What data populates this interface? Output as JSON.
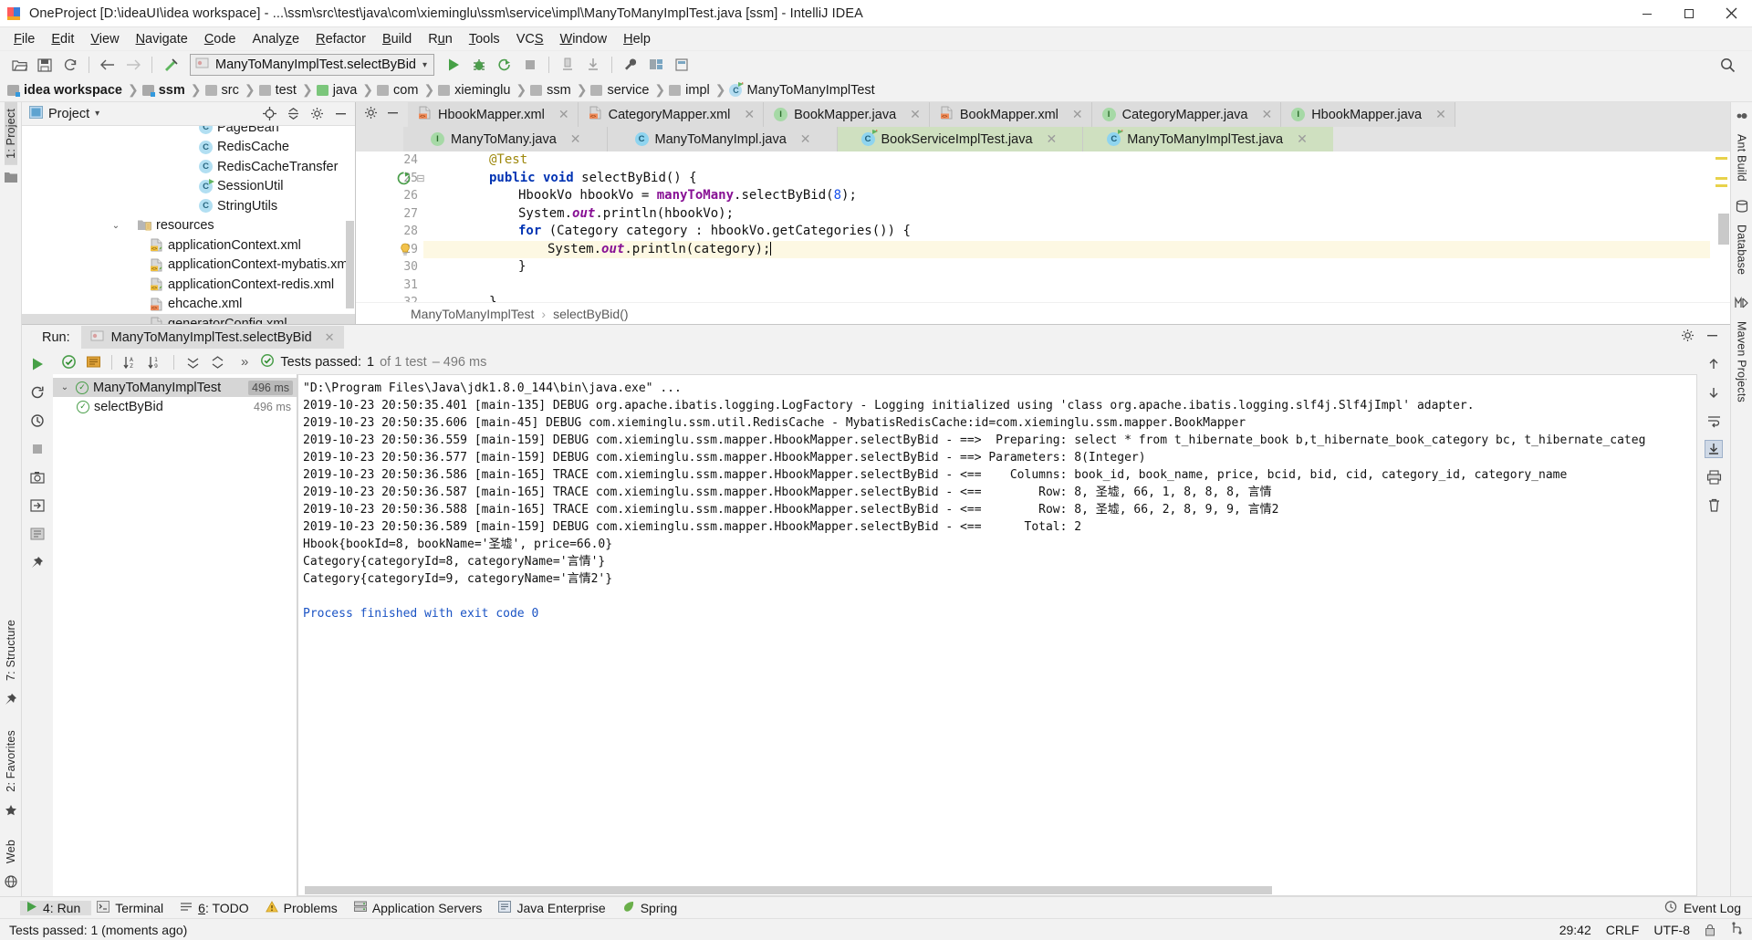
{
  "window": {
    "title": "OneProject [D:\\ideaUI\\idea workspace] - ...\\ssm\\src\\test\\java\\com\\xieminglu\\ssm\\service\\impl\\ManyToManyImplTest.java [ssm] - IntelliJ IDEA",
    "minimize_label": "Minimize",
    "maximize_label": "Maximize",
    "close_label": "Close"
  },
  "menubar": {
    "items": [
      {
        "label": "File"
      },
      {
        "label": "Edit"
      },
      {
        "label": "View"
      },
      {
        "label": "Navigate"
      },
      {
        "label": "Code"
      },
      {
        "label": "Analyze"
      },
      {
        "label": "Refactor"
      },
      {
        "label": "Build"
      },
      {
        "label": "Run"
      },
      {
        "label": "Tools"
      },
      {
        "label": "VCS"
      },
      {
        "label": "Window"
      },
      {
        "label": "Help"
      }
    ]
  },
  "toolbar": {
    "run_config": "ManyToManyImplTest.selectByBid",
    "icons": [
      "open-folder-icon",
      "save-icon",
      "sync-icon",
      "back-arrow-icon",
      "forward-arrow-icon",
      "build-icon",
      "run-icon",
      "debug-icon",
      "run-coverage-icon",
      "stop-icon",
      "profiler-icon",
      "update-app-icon",
      "settings-wrench-icon",
      "project-structure-icon",
      "sdk-manager-icon",
      "search-everywhere-icon"
    ]
  },
  "breadcrumbs": [
    {
      "label": "idea workspace",
      "icon": "module-folder-icon",
      "bold": true
    },
    {
      "label": "ssm",
      "icon": "module-folder-icon",
      "bold": true
    },
    {
      "label": "src",
      "icon": "folder-icon",
      "bold": false
    },
    {
      "label": "test",
      "icon": "folder-icon",
      "bold": false
    },
    {
      "label": "java",
      "icon": "source-root-folder-icon",
      "bold": false
    },
    {
      "label": "com",
      "icon": "package-icon",
      "bold": false
    },
    {
      "label": "xieminglu",
      "icon": "package-icon",
      "bold": false
    },
    {
      "label": "ssm",
      "icon": "package-icon",
      "bold": false
    },
    {
      "label": "service",
      "icon": "package-icon",
      "bold": false
    },
    {
      "label": "impl",
      "icon": "package-icon",
      "bold": false
    },
    {
      "label": "ManyToManyImplTest",
      "icon": "test-class-icon",
      "bold": false
    }
  ],
  "project_pane": {
    "title": "Project",
    "tree": [
      {
        "label": "PageBean",
        "icon": "class-icon",
        "indent": 4,
        "clipped": true
      },
      {
        "label": "RedisCache",
        "icon": "class-icon",
        "indent": 4
      },
      {
        "label": "RedisCacheTransfer",
        "icon": "class-icon",
        "indent": 4
      },
      {
        "label": "SessionUtil",
        "icon": "runnable-class-icon",
        "indent": 4
      },
      {
        "label": "StringUtils",
        "icon": "class-icon",
        "indent": 4
      },
      {
        "label": "resources",
        "icon": "resource-folder-icon",
        "indent": 2,
        "expanded": true
      },
      {
        "label": "applicationContext.xml",
        "icon": "spring-xml-icon",
        "indent": 3
      },
      {
        "label": "applicationContext-mybatis.xml",
        "icon": "spring-xml-icon",
        "indent": 3
      },
      {
        "label": "applicationContext-redis.xml",
        "icon": "spring-xml-icon",
        "indent": 3
      },
      {
        "label": "ehcache.xml",
        "icon": "xml-icon",
        "indent": 3
      },
      {
        "label": "generatorConfig.xml",
        "icon": "xml-icon",
        "indent": 3,
        "clipped": true
      }
    ]
  },
  "editor": {
    "tabs_row1": [
      {
        "label": "HbookMapper.xml",
        "icon": "xml-icon",
        "active": false
      },
      {
        "label": "CategoryMapper.xml",
        "icon": "xml-icon",
        "active": false
      },
      {
        "label": "BookMapper.java",
        "icon": "interface-icon",
        "active": false
      },
      {
        "label": "BookMapper.xml",
        "icon": "xml-icon",
        "active": false
      },
      {
        "label": "CategoryMapper.java",
        "icon": "interface-icon",
        "active": false
      },
      {
        "label": "HbookMapper.java",
        "icon": "interface-icon",
        "active": false
      }
    ],
    "tabs_row2": [
      {
        "label": "ManyToMany.java",
        "icon": "interface-icon",
        "active": false
      },
      {
        "label": "ManyToManyImpl.java",
        "icon": "class-icon",
        "active": false
      },
      {
        "label": "BookServiceImplTest.java",
        "icon": "test-class-icon",
        "active": true
      },
      {
        "label": "ManyToManyImplTest.java",
        "icon": "test-class-icon",
        "active": true
      }
    ],
    "lines": [
      {
        "num": "24",
        "indent": 4,
        "segments": [
          {
            "t": "@Test",
            "c": "ann"
          }
        ]
      },
      {
        "num": "25",
        "indent": 4,
        "segments": [
          {
            "t": "public void ",
            "c": "kw"
          },
          {
            "t": "selectByBid() {",
            "c": ""
          }
        ],
        "gutter_icon": "run-test-icon",
        "fold": true
      },
      {
        "num": "26",
        "indent": 8,
        "segments": [
          {
            "t": "HbookVo hbookVo = ",
            "c": ""
          },
          {
            "t": "manyToMany",
            "c": "fld"
          },
          {
            "t": ".selectByBid(",
            "c": ""
          },
          {
            "t": "8",
            "c": "num"
          },
          {
            "t": ");",
            "c": ""
          }
        ]
      },
      {
        "num": "27",
        "indent": 8,
        "segments": [
          {
            "t": "System.",
            "c": ""
          },
          {
            "t": "out",
            "c": "stat"
          },
          {
            "t": ".println(hbookVo);",
            "c": ""
          }
        ]
      },
      {
        "num": "28",
        "indent": 8,
        "segments": [
          {
            "t": "for ",
            "c": "kw"
          },
          {
            "t": "(Category category : hbookVo.getCategories()) {",
            "c": ""
          }
        ]
      },
      {
        "num": "29",
        "indent": 12,
        "segments": [
          {
            "t": "System.",
            "c": ""
          },
          {
            "t": "out",
            "c": "stat"
          },
          {
            "t": ".println(category);",
            "c": ""
          }
        ],
        "gutter_icon": "intention-bulb-icon",
        "highlight": true,
        "caret": true
      },
      {
        "num": "30",
        "indent": 8,
        "segments": [
          {
            "t": "}",
            "c": ""
          }
        ]
      },
      {
        "num": "31",
        "indent": 4,
        "segments": [
          {
            "t": "",
            "c": ""
          }
        ]
      },
      {
        "num": "32",
        "indent": 4,
        "segments": [
          {
            "t": "}",
            "c": ""
          }
        ],
        "fold": true
      }
    ],
    "crumb_class": "ManyToManyImplTest",
    "crumb_method": "selectByBid()"
  },
  "run_window": {
    "label": "Run:",
    "tab_title": "ManyToManyImplTest.selectByBid",
    "status_prefix": "Tests passed:",
    "status_count": "1",
    "status_suffix": "of 1 test",
    "status_time": "– 496 ms",
    "expand_chevrons": "»",
    "test_tree": [
      {
        "label": "ManyToManyImplTest",
        "duration": "496 ms",
        "selected": true,
        "expanded": true
      },
      {
        "label": "selectByBid",
        "duration": "496 ms",
        "selected": false,
        "indent": 1
      }
    ],
    "console": [
      {
        "text": "\"D:\\Program Files\\Java\\jdk1.8.0_144\\bin\\java.exe\" ...",
        "style": "cmd"
      },
      {
        "text": "2019-10-23 20:50:35.401 [main-135] DEBUG org.apache.ibatis.logging.LogFactory - Logging initialized using 'class org.apache.ibatis.logging.slf4j.Slf4jImpl' adapter.",
        "style": "plain"
      },
      {
        "text": "2019-10-23 20:50:35.606 [main-45] DEBUG com.xieminglu.ssm.util.RedisCache - MybatisRedisCache:id=com.xieminglu.ssm.mapper.BookMapper",
        "style": "plain"
      },
      {
        "text": "2019-10-23 20:50:36.559 [main-159] DEBUG com.xieminglu.ssm.mapper.HbookMapper.selectByBid - ==>  Preparing: select * from t_hibernate_book b,t_hibernate_book_category bc, t_hibernate_categ",
        "style": "plain"
      },
      {
        "text": "2019-10-23 20:50:36.577 [main-159] DEBUG com.xieminglu.ssm.mapper.HbookMapper.selectByBid - ==> Parameters: 8(Integer)",
        "style": "plain"
      },
      {
        "text": "2019-10-23 20:50:36.586 [main-165] TRACE com.xieminglu.ssm.mapper.HbookMapper.selectByBid - <==    Columns: book_id, book_name, price, bcid, bid, cid, category_id, category_name",
        "style": "plain"
      },
      {
        "text": "2019-10-23 20:50:36.587 [main-165] TRACE com.xieminglu.ssm.mapper.HbookMapper.selectByBid - <==        Row: 8, 圣墟, 66, 1, 8, 8, 8, 言情",
        "style": "plain"
      },
      {
        "text": "2019-10-23 20:50:36.588 [main-165] TRACE com.xieminglu.ssm.mapper.HbookMapper.selectByBid - <==        Row: 8, 圣墟, 66, 2, 8, 9, 9, 言情2",
        "style": "plain"
      },
      {
        "text": "2019-10-23 20:50:36.589 [main-159] DEBUG com.xieminglu.ssm.mapper.HbookMapper.selectByBid - <==      Total: 2",
        "style": "plain"
      },
      {
        "text": "Hbook{bookId=8, bookName='圣墟', price=66.0}",
        "style": "plain"
      },
      {
        "text": "Category{categoryId=8, categoryName='言情'}",
        "style": "plain"
      },
      {
        "text": "Category{categoryId=9, categoryName='言情2'}",
        "style": "plain"
      },
      {
        "text": "",
        "style": "plain"
      },
      {
        "text": "Process finished with exit code 0",
        "style": "blue"
      }
    ]
  },
  "left_rail": {
    "project_label": "1: Project",
    "structure_label": "7: Structure",
    "favorites_label": "2: Favorites",
    "web_label": "Web"
  },
  "right_rail": {
    "ant_label": "Ant Build",
    "database_label": "Database",
    "maven_label": "Maven Projects"
  },
  "bottom_bar": {
    "items": [
      {
        "label": "4: Run",
        "icon": "run-icon",
        "active": true
      },
      {
        "label": "Terminal",
        "icon": "terminal-icon",
        "active": false
      },
      {
        "label": "6: TODO",
        "icon": "todo-icon",
        "active": false
      },
      {
        "label": "Problems",
        "icon": "warning-icon",
        "active": false
      },
      {
        "label": "Application Servers",
        "icon": "server-icon",
        "active": false
      },
      {
        "label": "Java Enterprise",
        "icon": "java-ee-icon",
        "active": false
      },
      {
        "label": "Spring",
        "icon": "spring-leaf-icon",
        "active": false
      }
    ],
    "event_log": "Event Log"
  },
  "status_bar": {
    "message": "Tests passed: 1 (moments ago)",
    "caret_position": "29:42",
    "line_separator": "CRLF",
    "encoding": "UTF-8",
    "lock_icon": "lock-icon"
  },
  "colors": {
    "accent_green": "#4a9e4a",
    "tab_active": "#cfe0c0",
    "panel_bg": "#f2f2f2",
    "editor_bg": "#ffffff",
    "highlight_line": "#fdf8e3"
  }
}
